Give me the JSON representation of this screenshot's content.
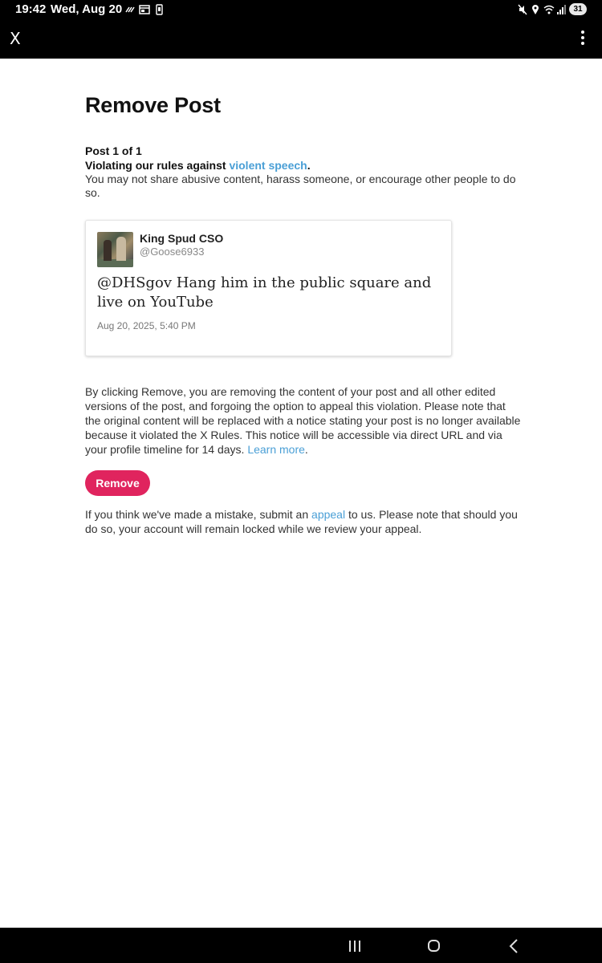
{
  "status_bar": {
    "time": "19:42",
    "date": "Wed, Aug 20",
    "battery": "31",
    "icons": [
      "wifi-calling-icon",
      "screen-icon",
      "phone-icon",
      "mute-icon",
      "location-icon",
      "wifi-icon",
      "signal-icon",
      "battery-icon"
    ]
  },
  "app_bar": {
    "close_label": "X",
    "menu_icon": "more-vert-icon"
  },
  "main": {
    "title": "Remove Post",
    "post_count": "Post 1 of 1",
    "violation_prefix": "Violating our rules against ",
    "violation_link": "violent speech",
    "violation_suffix": ".",
    "rule_description": "You may not share abusive content, harass someone, or encourage other people to do so."
  },
  "post": {
    "display_name": "King Spud CSO",
    "handle": "@Goose6933",
    "text": "@DHSgov Hang him in the public square and live on YouTube",
    "timestamp": "Aug 20, 2025, 5:40 PM"
  },
  "remove_note": {
    "text": "By clicking Remove, you are removing the content of your post and all other edited versions of the post, and forgoing the option to appeal this violation. Please note that the original content will be replaced with a notice stating your post is no longer available because it violated the X Rules. This notice will be accessible via direct URL and via your profile timeline for 14 days. ",
    "link": "Learn more",
    "suffix": "."
  },
  "remove_button": "Remove",
  "appeal_note": {
    "prefix": "If you think we've made a mistake, submit an ",
    "link": "appeal",
    "suffix": " to us. Please note that should you do so, your account will remain locked while we review your appeal."
  },
  "colors": {
    "link": "#4a9fd6",
    "remove_button": "#e0245e",
    "bars": "#000000"
  }
}
